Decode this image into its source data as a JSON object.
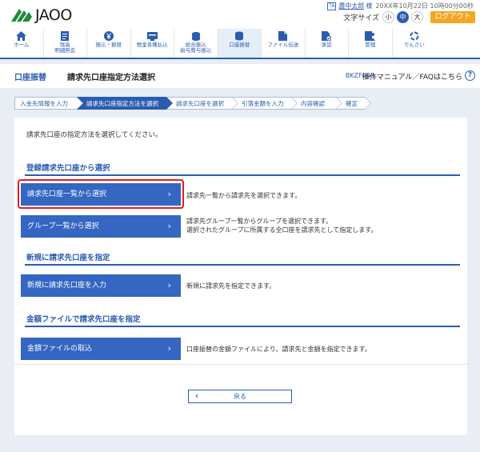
{
  "header": {
    "logo_text": "JAOO",
    "user_icon": "TA",
    "user_name": "農中太郎",
    "user_honorific": "様",
    "datetime": "20XX年10月22日 10時00分00秒",
    "font_size_label": "文字サイズ",
    "font_sizes": [
      "小",
      "中",
      "大"
    ],
    "font_size_selected": "中",
    "logout_label": "ログアウト"
  },
  "nav": {
    "items": [
      {
        "label": "ホーム",
        "icon": "home-icon"
      },
      {
        "label": "残高\n明細照会",
        "icon": "list-icon"
      },
      {
        "label": "振込・振替",
        "icon": "yen-icon"
      },
      {
        "label": "税金各種払込",
        "icon": "receipt-icon"
      },
      {
        "label": "総合振込\n給与賞与振込",
        "icon": "coins-icon"
      },
      {
        "label": "口座振替",
        "icon": "account-icon"
      },
      {
        "label": "ファイル伝送",
        "icon": "file-icon"
      },
      {
        "label": "承認",
        "icon": "approve-icon"
      },
      {
        "label": "管理",
        "icon": "admin-icon"
      },
      {
        "label": "でんさい",
        "icon": "densai-icon"
      }
    ],
    "active_index": 5
  },
  "titlebar": {
    "category": "口座振替",
    "title": "請求先口座指定方法選択",
    "screen_id": "BKZF003",
    "manual_link": "操作マニュアル／FAQはこちら",
    "help_icon": "?"
  },
  "steps": [
    "入金先情報を入力",
    "請求先口座指定方法を選択",
    "請求先口座を選択",
    "引落金額を入力",
    "内容確認",
    "確定"
  ],
  "steps_current": 1,
  "main": {
    "intro": "請求先口座の指定方法を選択してください。",
    "sections": [
      {
        "title": "登録請求先口座から選択",
        "actions": [
          {
            "label": "請求先口座一覧から選択",
            "desc": "請求先一覧から請求先を選択できます。"
          },
          {
            "label": "グループ一覧から選択",
            "desc": "請求先グループ一覧からグループを選択できます。\n選択されたグループに所属する全口座を請求先として指定します。"
          }
        ]
      },
      {
        "title": "新規に請求先口座を指定",
        "actions": [
          {
            "label": "新規に請求先口座を入力",
            "desc": "新規に請求先を指定できます。"
          }
        ]
      },
      {
        "title": "金額ファイルで請求先口座を指定",
        "actions": [
          {
            "label": "金額ファイルの取込",
            "desc": "口座振替の金額ファイルにより、請求先と金額を指定できます。"
          }
        ]
      }
    ],
    "chevron": "›",
    "back_label": "戻る",
    "back_chevron": "‹"
  },
  "colors": {
    "primary": "#2a5db0",
    "button": "#3466c2",
    "logout": "#f5a623",
    "highlight": "#e8191b",
    "background": "#e9eef4"
  }
}
